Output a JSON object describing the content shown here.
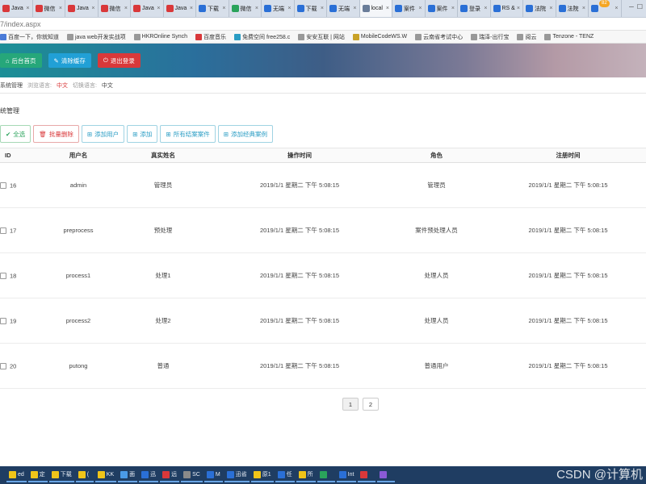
{
  "browser": {
    "tabs": [
      {
        "label": "Java",
        "icon": "c-icon",
        "color": "#d9383a"
      },
      {
        "label": "微信",
        "icon": "doc-icon",
        "color": "#d9383a"
      },
      {
        "label": "Java",
        "icon": "c-icon",
        "color": "#d9383a"
      },
      {
        "label": "微信",
        "icon": "c-icon",
        "color": "#d9383a"
      },
      {
        "label": "Java",
        "icon": "c-icon",
        "color": "#d9383a"
      },
      {
        "label": "Java",
        "icon": "c-icon",
        "color": "#d9383a"
      },
      {
        "label": "下载",
        "icon": "doc-icon",
        "color": "#2a6fd6"
      },
      {
        "label": "微信",
        "icon": "wechat-icon",
        "color": "#2aa35b"
      },
      {
        "label": "无端",
        "icon": "doc-icon",
        "color": "#2a6fd6"
      },
      {
        "label": "下载",
        "icon": "doc-icon",
        "color": "#2a6fd6"
      },
      {
        "label": "无端",
        "icon": "doc-icon",
        "color": "#2a6fd6"
      },
      {
        "label": "local",
        "icon": "globe-icon",
        "color": "#6a7d99"
      },
      {
        "label": "案件",
        "icon": "doc-icon",
        "color": "#2a6fd6"
      },
      {
        "label": "案件",
        "icon": "doc-icon",
        "color": "#2a6fd6"
      },
      {
        "label": "登录",
        "icon": "doc-icon",
        "color": "#2a6fd6"
      },
      {
        "label": "RS &",
        "icon": "doc-icon",
        "color": "#2a6fd6"
      },
      {
        "label": "法院",
        "icon": "doc-icon",
        "color": "#2a6fd6"
      },
      {
        "label": "法院",
        "icon": "doc-icon",
        "color": "#2a6fd6"
      },
      {
        "label": "",
        "icon": "doc-icon",
        "color": "#2a6fd6"
      }
    ],
    "tab_badge": "82",
    "address": "7/index.aspx",
    "bookmarks": [
      {
        "label": "百度一下，你就知道",
        "color": "#4a7bd8"
      },
      {
        "label": "java web开发实战项",
        "color": "#999999"
      },
      {
        "label": "HKROnline Synch",
        "color": "#999999"
      },
      {
        "label": "百度音乐",
        "color": "#d9383a"
      },
      {
        "label": "免费空间 free258.c",
        "color": "#2a9dc4"
      },
      {
        "label": "安安互联 | 网站",
        "color": "#999999"
      },
      {
        "label": "MobileCodeWS.W",
        "color": "#c9a227"
      },
      {
        "label": "云南省考试中心",
        "color": "#999999"
      },
      {
        "label": "瑞泽-出行宝",
        "color": "#999999"
      },
      {
        "label": "阅云",
        "color": "#999999"
      },
      {
        "label": "Tenzone - TENZ",
        "color": "#999999"
      }
    ]
  },
  "header": {
    "home_label": "后台首页",
    "clear_label": "清除缓存",
    "logout_label": "退出登录"
  },
  "info": {
    "segment_1": "系统管理",
    "lang_label_1": "浏览语言:",
    "lang_value_1": "中文",
    "lang_label_2": "切换语言:",
    "lang_value_2": "中文"
  },
  "section_title": "统管理",
  "toolbar": {
    "select_all": "全选",
    "batch_delete": "批量删除",
    "add_user": "添加用户",
    "add": "添加",
    "all_cases": "所有结案案件",
    "add_classic_case": "添加经典案例"
  },
  "table": {
    "headers": [
      "ID",
      "用户名",
      "真实姓名",
      "操作时间",
      "角色",
      "注册时间"
    ],
    "rows": [
      {
        "id": "16",
        "username": "admin",
        "realname": "管理员",
        "op_time": "2019/1/1 星期二 下午 5:08:15",
        "role": "管理员",
        "reg_time": "2019/1/1 星期二 下午 5:08:15"
      },
      {
        "id": "17",
        "username": "preprocess",
        "realname": "预处理",
        "op_time": "2019/1/1 星期二 下午 5:08:15",
        "role": "案件预处理人员",
        "reg_time": "2019/1/1 星期二 下午 5:08:15"
      },
      {
        "id": "18",
        "username": "process1",
        "realname": "处理1",
        "op_time": "2019/1/1 星期二 下午 5:08:15",
        "role": "处理人员",
        "reg_time": "2019/1/1 星期二 下午 5:08:15"
      },
      {
        "id": "19",
        "username": "process2",
        "realname": "处理2",
        "op_time": "2019/1/1 星期二 下午 5:08:15",
        "role": "处理人员",
        "reg_time": "2019/1/1 星期二 下午 5:08:15"
      },
      {
        "id": "20",
        "username": "putong",
        "realname": "普通",
        "op_time": "2019/1/1 星期二 下午 5:08:15",
        "role": "普通用户",
        "reg_time": "2019/1/1 星期二 下午 5:08:15"
      }
    ]
  },
  "pagination": [
    "1",
    "2"
  ],
  "taskbar": {
    "items": [
      {
        "label": "ed",
        "color": "#f0c419"
      },
      {
        "label": "定",
        "color": "#f0c419"
      },
      {
        "label": "下载",
        "color": "#f0c419"
      },
      {
        "label": "(",
        "color": "#f0c419"
      },
      {
        "label": "KK",
        "color": "#f0c419"
      },
      {
        "label": "面",
        "color": "#4a9be8"
      },
      {
        "label": "迅",
        "color": "#2a6fd6"
      },
      {
        "label": "远",
        "color": "#d9383a"
      },
      {
        "label": "SC",
        "color": "#8a8a8a"
      },
      {
        "label": "M",
        "color": "#2a6fd6"
      },
      {
        "label": "迅省",
        "color": "#2a6fd6"
      },
      {
        "label": "原1",
        "color": "#f0c419"
      },
      {
        "label": "任",
        "color": "#2a6fd6"
      },
      {
        "label": "所",
        "color": "#f0c419"
      },
      {
        "label": "",
        "color": "#2aa35b"
      },
      {
        "label": "Int",
        "color": "#2a6fd6"
      },
      {
        "label": "",
        "color": "#d9383a"
      },
      {
        "label": "",
        "color": "#8a5ad6"
      }
    ],
    "watermark": "CSDN @计算机"
  }
}
